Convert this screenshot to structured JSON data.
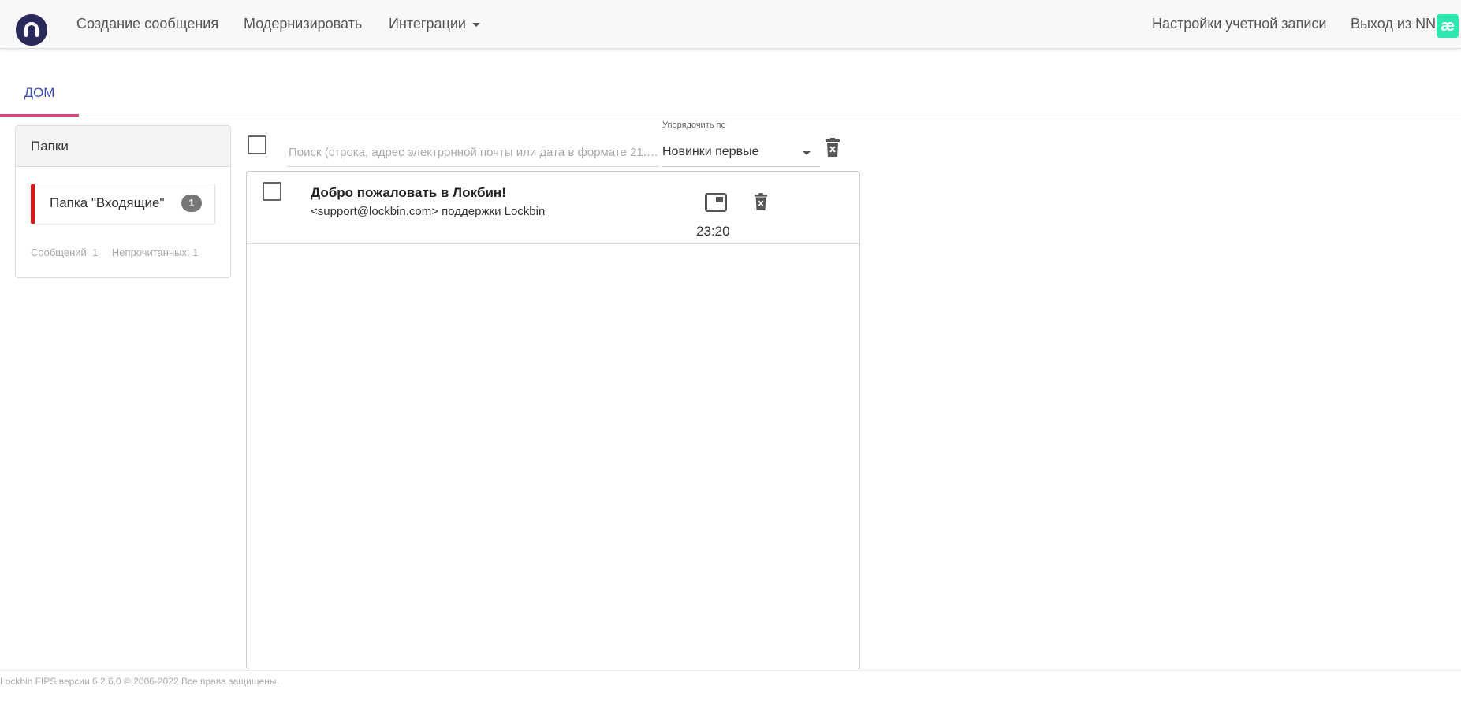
{
  "nav": {
    "items": [
      {
        "label": "Создание сообщения"
      },
      {
        "label": "Модернизировать"
      },
      {
        "label": "Интеграции"
      }
    ],
    "account_settings": "Настройки учетной записи",
    "logout": "Выход из NN",
    "extension_glyph": "æ",
    "logo_icon": "lockbin-logo-icon"
  },
  "tabs": {
    "home": "ДОМ"
  },
  "folders": {
    "header": "Папки",
    "inbox": {
      "label": "Папка \"Входящие\"",
      "unread_badge": "1"
    },
    "stats": {
      "messages": "Сообщений: 1",
      "unread": "Непрочитанных: 1"
    }
  },
  "toolbar": {
    "search_placeholder": "Поиск (строка, адрес электронной почты или дата в формате 21.…",
    "sort_label": "Упорядочить по",
    "sort_value": "Новинки первые"
  },
  "messages": [
    {
      "subject": "Добро пожаловать в Локбин!",
      "from": "<support@lockbin.com> поддержки Lockbin",
      "time": "23:20"
    }
  ],
  "footer": {
    "text": "Lockbin FIPS версии 6.2.6.0 © 2006-2022 Все права защищены."
  },
  "colors": {
    "accent_tab": "#3f51b5",
    "tab_underline": "#e0457b",
    "folder_marker": "#d61a1a",
    "logo_bg": "#2a2a5a",
    "extension_icon": "#2ee6b0"
  }
}
